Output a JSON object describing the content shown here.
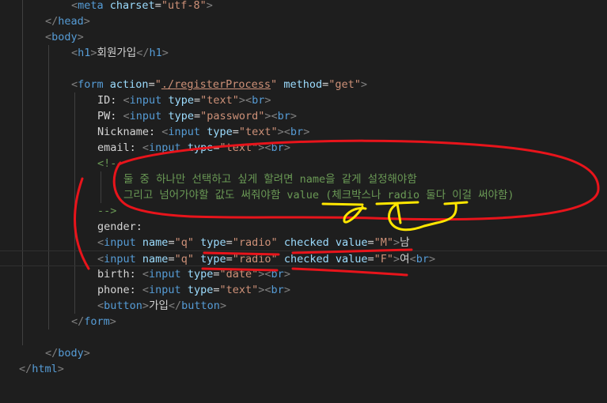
{
  "editor": {
    "background": "#1e1e1e",
    "token_colors": {
      "bracket": "#808080",
      "tag": "#569cd6",
      "attribute": "#9cdcfe",
      "string": "#ce9178",
      "text": "#d4d4d4",
      "comment": "#6a9955"
    },
    "annotation_colors": {
      "red": "#e8141b",
      "yellow": "#ffe600"
    },
    "lines": [
      {
        "indent": 2,
        "tokens": [
          [
            "bracket",
            "<"
          ],
          [
            "tag",
            "meta"
          ],
          [
            "text",
            " "
          ],
          [
            "attr",
            "charset"
          ],
          [
            "text",
            "="
          ],
          [
            "str",
            "\"utf-8\""
          ],
          [
            "bracket",
            ">"
          ]
        ]
      },
      {
        "indent": 1,
        "tokens": [
          [
            "bracket",
            "</"
          ],
          [
            "tag",
            "head"
          ],
          [
            "bracket",
            ">"
          ]
        ]
      },
      {
        "indent": 1,
        "tokens": [
          [
            "bracket",
            "<"
          ],
          [
            "tag",
            "body"
          ],
          [
            "bracket",
            ">"
          ]
        ]
      },
      {
        "indent": 2,
        "tokens": [
          [
            "bracket",
            "<"
          ],
          [
            "tag",
            "h1"
          ],
          [
            "bracket",
            ">"
          ],
          [
            "text",
            "회원가입"
          ],
          [
            "bracket",
            "</"
          ],
          [
            "tag",
            "h1"
          ],
          [
            "bracket",
            ">"
          ]
        ]
      },
      {
        "indent": 0,
        "tokens": []
      },
      {
        "indent": 2,
        "tokens": [
          [
            "bracket",
            "<"
          ],
          [
            "tag",
            "form"
          ],
          [
            "text",
            " "
          ],
          [
            "attr",
            "action"
          ],
          [
            "text",
            "="
          ],
          [
            "str",
            "\""
          ],
          [
            "strlink",
            "./registerProcess"
          ],
          [
            "str",
            "\""
          ],
          [
            "text",
            " "
          ],
          [
            "attr",
            "method"
          ],
          [
            "text",
            "="
          ],
          [
            "str",
            "\"get\""
          ],
          [
            "bracket",
            ">"
          ]
        ]
      },
      {
        "indent": 3,
        "tokens": [
          [
            "text",
            "ID: "
          ],
          [
            "bracket",
            "<"
          ],
          [
            "tag",
            "input"
          ],
          [
            "text",
            " "
          ],
          [
            "attr",
            "type"
          ],
          [
            "text",
            "="
          ],
          [
            "str",
            "\"text\""
          ],
          [
            "bracket",
            ">"
          ],
          [
            "bracket",
            "<"
          ],
          [
            "tag",
            "br"
          ],
          [
            "bracket",
            ">"
          ]
        ]
      },
      {
        "indent": 3,
        "tokens": [
          [
            "text",
            "PW: "
          ],
          [
            "bracket",
            "<"
          ],
          [
            "tag",
            "input"
          ],
          [
            "text",
            " "
          ],
          [
            "attr",
            "type"
          ],
          [
            "text",
            "="
          ],
          [
            "str",
            "\"password\""
          ],
          [
            "bracket",
            ">"
          ],
          [
            "bracket",
            "<"
          ],
          [
            "tag",
            "br"
          ],
          [
            "bracket",
            ">"
          ]
        ]
      },
      {
        "indent": 3,
        "tokens": [
          [
            "text",
            "Nickname: "
          ],
          [
            "bracket",
            "<"
          ],
          [
            "tag",
            "input"
          ],
          [
            "text",
            " "
          ],
          [
            "attr",
            "type"
          ],
          [
            "text",
            "="
          ],
          [
            "str",
            "\"text\""
          ],
          [
            "bracket",
            ">"
          ],
          [
            "bracket",
            "<"
          ],
          [
            "tag",
            "br"
          ],
          [
            "bracket",
            ">"
          ]
        ]
      },
      {
        "indent": 3,
        "tokens": [
          [
            "text",
            "email: "
          ],
          [
            "bracket",
            "<"
          ],
          [
            "tag",
            "input"
          ],
          [
            "text",
            " "
          ],
          [
            "attr",
            "type"
          ],
          [
            "text",
            "="
          ],
          [
            "str",
            "\"text\""
          ],
          [
            "bracket",
            ">"
          ],
          [
            "bracket",
            "<"
          ],
          [
            "tag",
            "br"
          ],
          [
            "bracket",
            ">"
          ]
        ]
      },
      {
        "indent": 3,
        "tokens": [
          [
            "comment",
            "<!--"
          ]
        ]
      },
      {
        "indent": 4,
        "tokens": [
          [
            "comment",
            "둘 중 하나만 선택하고 싶게 할려면 name을 같게 설정해야함"
          ]
        ]
      },
      {
        "indent": 4,
        "tokens": [
          [
            "comment",
            "그리고 넘어가야할 값도 써줘야함 value (체크박스나 radio 둘다 이걸 써야함)"
          ]
        ]
      },
      {
        "indent": 3,
        "tokens": [
          [
            "comment",
            "-->"
          ]
        ]
      },
      {
        "indent": 3,
        "tokens": [
          [
            "text",
            "gender:"
          ]
        ]
      },
      {
        "indent": 3,
        "tokens": [
          [
            "bracket",
            "<"
          ],
          [
            "tag",
            "input"
          ],
          [
            "text",
            " "
          ],
          [
            "attr",
            "name"
          ],
          [
            "text",
            "="
          ],
          [
            "str",
            "\"q\""
          ],
          [
            "text",
            " "
          ],
          [
            "attr",
            "type"
          ],
          [
            "text",
            "="
          ],
          [
            "str",
            "\"radio\""
          ],
          [
            "text",
            " "
          ],
          [
            "attr",
            "checked"
          ],
          [
            "text",
            " "
          ],
          [
            "attr",
            "value"
          ],
          [
            "text",
            "="
          ],
          [
            "str",
            "\"M\""
          ],
          [
            "bracket",
            ">"
          ],
          [
            "text",
            "남"
          ]
        ]
      },
      {
        "indent": 3,
        "tokens": [
          [
            "bracket",
            "<"
          ],
          [
            "tag",
            "input"
          ],
          [
            "text",
            " "
          ],
          [
            "attr",
            "name"
          ],
          [
            "text",
            "="
          ],
          [
            "str",
            "\"q\""
          ],
          [
            "text",
            " "
          ],
          [
            "attr",
            "type"
          ],
          [
            "text",
            "="
          ],
          [
            "str",
            "\"radio\""
          ],
          [
            "text",
            " "
          ],
          [
            "attr",
            "checked"
          ],
          [
            "text",
            " "
          ],
          [
            "attr",
            "value"
          ],
          [
            "text",
            "="
          ],
          [
            "str",
            "\"F\""
          ],
          [
            "bracket",
            ">"
          ],
          [
            "text",
            "여"
          ],
          [
            "bracket",
            "<"
          ],
          [
            "tag",
            "br"
          ],
          [
            "bracket",
            ">"
          ]
        ]
      },
      {
        "indent": 3,
        "tokens": [
          [
            "text",
            "birth: "
          ],
          [
            "bracket",
            "<"
          ],
          [
            "tag",
            "input"
          ],
          [
            "text",
            " "
          ],
          [
            "attr",
            "type"
          ],
          [
            "text",
            "="
          ],
          [
            "str",
            "\"date\""
          ],
          [
            "bracket",
            ">"
          ],
          [
            "bracket",
            "<"
          ],
          [
            "tag",
            "br"
          ],
          [
            "bracket",
            ">"
          ]
        ]
      },
      {
        "indent": 3,
        "tokens": [
          [
            "text",
            "phone: "
          ],
          [
            "bracket",
            "<"
          ],
          [
            "tag",
            "input"
          ],
          [
            "text",
            " "
          ],
          [
            "attr",
            "type"
          ],
          [
            "text",
            "="
          ],
          [
            "str",
            "\"text\""
          ],
          [
            "bracket",
            ">"
          ],
          [
            "bracket",
            "<"
          ],
          [
            "tag",
            "br"
          ],
          [
            "bracket",
            ">"
          ]
        ]
      },
      {
        "indent": 3,
        "tokens": [
          [
            "bracket",
            "<"
          ],
          [
            "tag",
            "button"
          ],
          [
            "bracket",
            ">"
          ],
          [
            "text",
            "가입"
          ],
          [
            "bracket",
            "</"
          ],
          [
            "tag",
            "button"
          ],
          [
            "bracket",
            ">"
          ]
        ]
      },
      {
        "indent": 2,
        "tokens": [
          [
            "bracket",
            "</"
          ],
          [
            "tag",
            "form"
          ],
          [
            "bracket",
            ">"
          ]
        ]
      },
      {
        "indent": 0,
        "tokens": []
      },
      {
        "indent": 1,
        "tokens": [
          [
            "bracket",
            "</"
          ],
          [
            "tag",
            "body"
          ],
          [
            "bracket",
            ">"
          ]
        ]
      },
      {
        "indent": 0,
        "tokens": [
          [
            "bracket",
            "</"
          ],
          [
            "tag",
            "html"
          ],
          [
            "bracket",
            ">"
          ]
        ]
      }
    ]
  }
}
